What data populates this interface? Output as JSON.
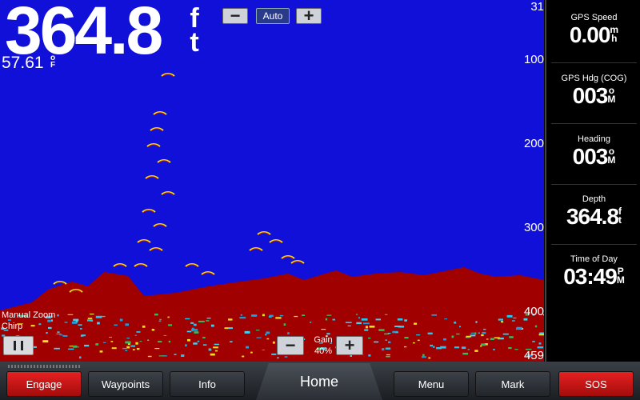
{
  "depth_display": {
    "value": "364.8",
    "unit_top": "f",
    "unit_bottom": "t"
  },
  "water_temp": {
    "value": "57.61",
    "unit_top": "o",
    "unit_bottom": "F"
  },
  "zoom_controls": {
    "minus": "−",
    "mode": "Auto",
    "plus": "+"
  },
  "depth_scale": [
    "31",
    "100",
    "200",
    "300",
    "400",
    "459"
  ],
  "mode_labels": {
    "zoom": "Manual Zoom",
    "frequency": "Chirp"
  },
  "gain": {
    "minus": "−",
    "label": "Gain",
    "value": "40%",
    "plus": "+"
  },
  "panel": {
    "gps_speed": {
      "label": "GPS Speed",
      "value": "0.00",
      "unit_top": "m",
      "unit_bottom": "h"
    },
    "gps_heading": {
      "label": "GPS Hdg (COG)",
      "value": "003",
      "unit_top": "o",
      "unit_bottom": "M"
    },
    "heading": {
      "label": "Heading",
      "value": "003",
      "unit_top": "o",
      "unit_bottom": "M"
    },
    "depth": {
      "label": "Depth",
      "value": "364.8",
      "unit_top": "f",
      "unit_bottom": "t"
    },
    "time": {
      "label": "Time of Day",
      "value": "03:49",
      "unit_top": "P",
      "unit_bottom": "M"
    }
  },
  "bottom_bar": {
    "engage": "Engage",
    "waypoints": "Waypoints",
    "info": "Info",
    "home": "Home",
    "menu": "Menu",
    "mark": "Mark",
    "sos": "SOS"
  },
  "colors": {
    "water": "#1010d8",
    "bottom_return": "#a00000",
    "alarm_button": "#e62020"
  }
}
